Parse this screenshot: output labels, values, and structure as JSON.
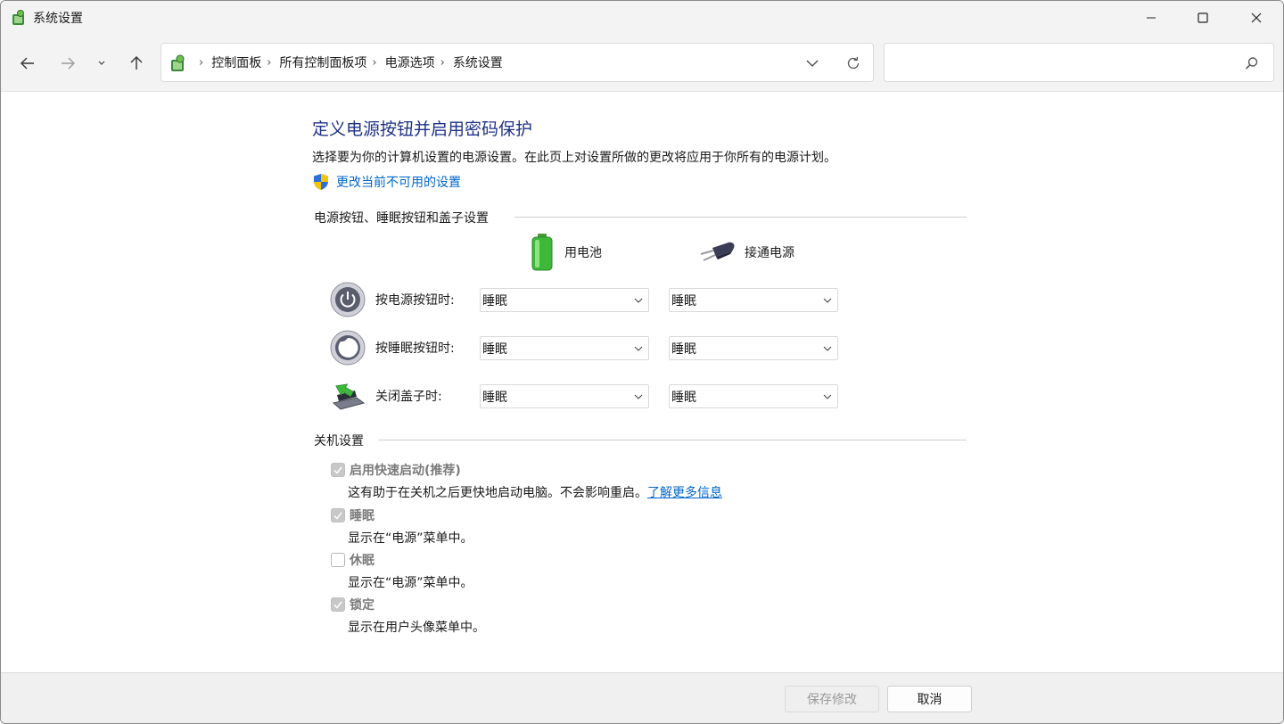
{
  "window": {
    "title": "系统设置"
  },
  "breadcrumbs": [
    "控制面板",
    "所有控制面板项",
    "电源选项",
    "系统设置"
  ],
  "search": {
    "value": "",
    "placeholder": ""
  },
  "page": {
    "heading": "定义电源按钮并启用密码保护",
    "description": "选择要为你的计算机设置的电源设置。在此页上对设置所做的更改将应用于你所有的电源计划。",
    "change_unavailable_link": "更改当前不可用的设置"
  },
  "buttons_section": {
    "title": "电源按钮、睡眠按钮和盖子设置",
    "columns": {
      "battery": "用电池",
      "plugged_in": "接通电源"
    },
    "rows": [
      {
        "label": "按电源按钮时:",
        "battery": "睡眠",
        "plugged_in": "睡眠"
      },
      {
        "label": "按睡眠按钮时:",
        "battery": "睡眠",
        "plugged_in": "睡眠"
      },
      {
        "label": "关闭盖子时:",
        "battery": "睡眠",
        "plugged_in": "睡眠"
      }
    ]
  },
  "shutdown_section": {
    "title": "关机设置",
    "options": [
      {
        "label": "启用快速启动(推荐)",
        "checked": true,
        "description": "这有助于在关机之后更快地启动电脑。不会影响重启。",
        "link": "了解更多信息"
      },
      {
        "label": "睡眠",
        "checked": true,
        "description": "显示在“电源”菜单中。"
      },
      {
        "label": "休眠",
        "checked": false,
        "description": "显示在“电源”菜单中。"
      },
      {
        "label": "锁定",
        "checked": true,
        "description": "显示在用户头像菜单中。"
      }
    ]
  },
  "footer": {
    "save_label": "保存修改",
    "cancel_label": "取消"
  },
  "colors": {
    "heading": "#1e3287",
    "link": "#0066cc",
    "chrome": "#f3f3f3"
  }
}
